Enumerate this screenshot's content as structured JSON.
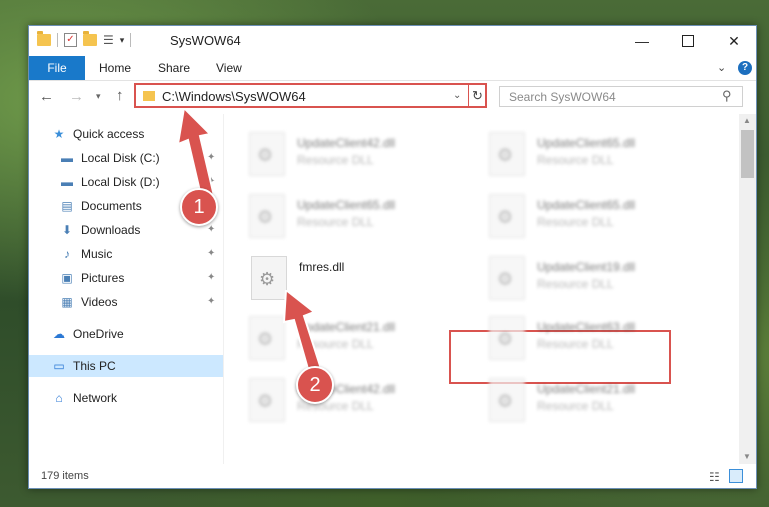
{
  "window": {
    "title": "SysWOW64"
  },
  "qat": {
    "check_glyph": "✓",
    "props_glyph": "☰",
    "dropdown_glyph": "▾"
  },
  "caption_buttons": {
    "minimize": "—",
    "close": "✕"
  },
  "ribbon": {
    "tabs": [
      "File",
      "Home",
      "Share",
      "View"
    ],
    "expand_glyph": "⌄",
    "help_glyph": "?"
  },
  "navigation": {
    "back": "←",
    "forward": "→",
    "recent": "▾",
    "up": "↑"
  },
  "address_bar": {
    "path": "C:\\Windows\\SysWOW64",
    "dropdown_glyph": "⌄",
    "refresh_glyph": "↻"
  },
  "search": {
    "placeholder": "Search SysWOW64",
    "icon": "⚲"
  },
  "nav_pane": {
    "quick_access": {
      "label": "Quick access",
      "icon": "star-icon",
      "glyph": "★",
      "color": "#3b8fd9"
    },
    "items": [
      {
        "label": "Local Disk (C:)",
        "icon": "drive-icon",
        "glyph": "▬",
        "pinned": true
      },
      {
        "label": "Local Disk (D:)",
        "icon": "drive-icon",
        "glyph": "▬",
        "pinned": true
      },
      {
        "label": "Documents",
        "icon": "documents-icon",
        "glyph": "▤",
        "pinned": true
      },
      {
        "label": "Downloads",
        "icon": "download-icon",
        "glyph": "⬇",
        "pinned": true
      },
      {
        "label": "Music",
        "icon": "music-icon",
        "glyph": "♪",
        "pinned": true
      },
      {
        "label": "Pictures",
        "icon": "pictures-icon",
        "glyph": "▣",
        "pinned": true
      },
      {
        "label": "Videos",
        "icon": "videos-icon",
        "glyph": "▦",
        "pinned": true
      }
    ],
    "pin_glyph": "✦",
    "onedrive": {
      "label": "OneDrive",
      "glyph": "☁"
    },
    "this_pc": {
      "label": "This PC",
      "glyph": "▭",
      "selected": true
    },
    "network": {
      "label": "Network",
      "glyph": "⌂"
    }
  },
  "files": [
    {
      "name": "UpdateClient42.dll",
      "type": "Resource DLL",
      "blurred": true
    },
    {
      "name": "UpdateClient65.dll",
      "type": "Resource DLL",
      "blurred": true
    },
    {
      "name": "UpdateClient65.dll",
      "type": "Resource DLL",
      "blurred": true
    },
    {
      "name": "UpdateClient65.dll",
      "type": "Resource DLL",
      "blurred": true
    },
    {
      "name": "fmres.dll",
      "type": "",
      "blurred": false,
      "highlighted": true
    },
    {
      "name": "UpdateClient19.dll",
      "type": "Resource DLL",
      "blurred": true
    },
    {
      "name": "UpdateClient21.dll",
      "type": "Resource DLL",
      "blurred": true
    },
    {
      "name": "UpdateClient63.dll",
      "type": "Resource DLL",
      "blurred": true
    },
    {
      "name": "UpdateClient42.dll",
      "type": "Resource DLL",
      "blurred": true
    },
    {
      "name": "UpdateClient21.dll",
      "type": "Resource DLL",
      "blurred": true
    }
  ],
  "file_icon_glyph": "⚙",
  "scrollbar": {
    "up": "▲",
    "down": "▼"
  },
  "status_bar": {
    "item_count": "179 items",
    "details_glyph": "☷"
  },
  "callouts": [
    {
      "number": "1",
      "color": "#d9534f"
    },
    {
      "number": "2",
      "color": "#d9534f"
    }
  ]
}
